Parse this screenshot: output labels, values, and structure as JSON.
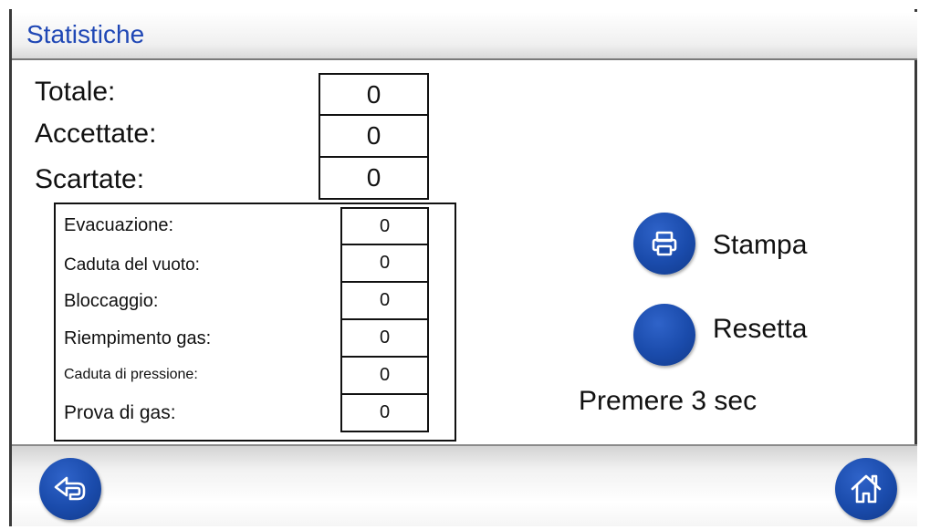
{
  "header": {
    "title": "Statistiche"
  },
  "summary": [
    {
      "label": "Totale:",
      "value": "0"
    },
    {
      "label": "Accettate:",
      "value": "0"
    },
    {
      "label": "Scartate:",
      "value": "0"
    }
  ],
  "rejects": [
    {
      "label": "Evacuazione:",
      "value": "0"
    },
    {
      "label": "Caduta del vuoto:",
      "value": "0"
    },
    {
      "label": "Bloccaggio:",
      "value": "0"
    },
    {
      "label": "Riempimento gas:",
      "value": "0"
    },
    {
      "label": "Caduta di pressione:",
      "value": "0"
    },
    {
      "label": "Prova di gas:",
      "value": "0"
    }
  ],
  "actions": {
    "print_label": "Stampa",
    "reset_label": "Resetta",
    "reset_hint": "Premere 3 sec"
  },
  "icons": {
    "print": "printer-icon",
    "back": "back-arrow-icon",
    "home": "home-icon"
  },
  "colors": {
    "accent": "#1a4bab",
    "title": "#1f47b5"
  }
}
